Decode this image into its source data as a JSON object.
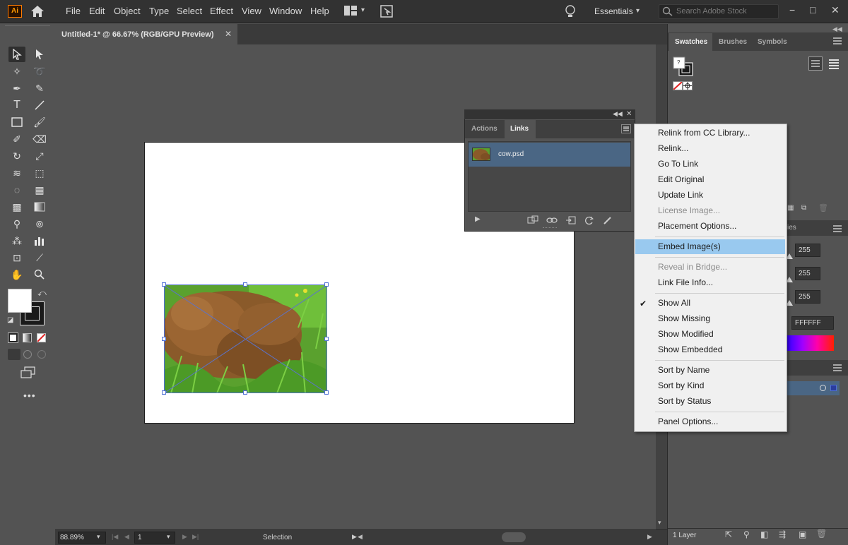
{
  "app": {
    "logo": "Ai",
    "menus": [
      "File",
      "Edit",
      "Object",
      "Type",
      "Select",
      "Effect",
      "View",
      "Window",
      "Help"
    ],
    "workspace": "Essentials",
    "search_placeholder": "Search Adobe Stock",
    "window_controls": [
      "−",
      "□",
      "✕"
    ]
  },
  "document": {
    "tab_title": "Untitled-1* @ 66.67% (RGB/GPU Preview)",
    "close_glyph": "✕"
  },
  "statusbar": {
    "zoom": "88.89%",
    "page": "1",
    "tool": "Selection"
  },
  "swatches_panel": {
    "tabs": [
      "Swatches",
      "Brushes",
      "Symbols"
    ]
  },
  "color_panel": {
    "tab_fragment": "ies",
    "r": "255",
    "g": "255",
    "b": "255",
    "hex": "FFFFFF"
  },
  "layers_panel": {
    "count": "1 Layer"
  },
  "links_panel": {
    "tabs": [
      "Actions",
      "Links"
    ],
    "items": [
      {
        "name": "cow.psd"
      }
    ]
  },
  "context_menu": {
    "items": [
      {
        "label": "Relink from CC Library...",
        "enabled": true
      },
      {
        "label": "Relink...",
        "enabled": true
      },
      {
        "label": "Go To Link",
        "enabled": true
      },
      {
        "label": "Edit Original",
        "enabled": true
      },
      {
        "label": "Update Link",
        "enabled": true
      },
      {
        "label": "License Image...",
        "enabled": false
      },
      {
        "label": "Placement Options...",
        "enabled": true
      },
      {
        "label": "Embed Image(s)",
        "enabled": true,
        "highlighted": true
      },
      {
        "label": "Reveal in Bridge...",
        "enabled": false
      },
      {
        "label": "Link File Info...",
        "enabled": true
      },
      {
        "label": "Show All",
        "enabled": true,
        "checked": true
      },
      {
        "label": "Show Missing",
        "enabled": true
      },
      {
        "label": "Show Modified",
        "enabled": true
      },
      {
        "label": "Show Embedded",
        "enabled": true
      },
      {
        "label": "Sort by Name",
        "enabled": true
      },
      {
        "label": "Sort by Kind",
        "enabled": true
      },
      {
        "label": "Sort by Status",
        "enabled": true
      },
      {
        "label": "Panel Options...",
        "enabled": true
      }
    ],
    "check_glyph": "✔"
  },
  "colors": {
    "accent": "#ff7c00",
    "selection": "#4f6fd6",
    "menu_highlight": "#99c9ef"
  }
}
